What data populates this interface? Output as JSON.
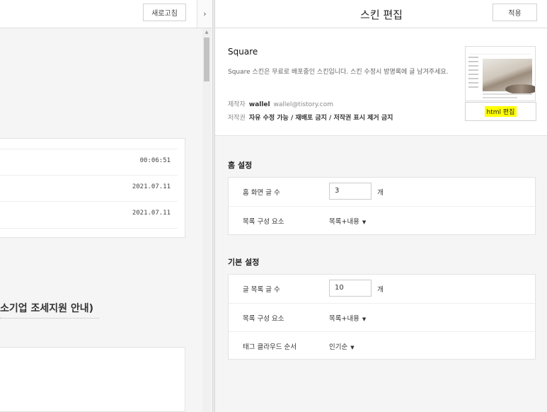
{
  "preview": {
    "refresh_label": "새로고침",
    "collapse_icon": "›",
    "scroll_up_icon": "▲",
    "recent_dates": [
      "00:06:51",
      "2021.07.11",
      "2021.07.11"
    ],
    "section_title": "소기업 조세지원 안내)"
  },
  "editor": {
    "title": "스킨 편집",
    "apply_label": "적용",
    "skin": {
      "name": "Square",
      "description": "Square 스킨은 무료로 배포중인 스킨입니다. 스킨 수정시 방명록에 글 남겨주세요.",
      "author_label": "제작자",
      "author_name": "wallel",
      "author_email": "wallel@tistory.com",
      "license_label": "저작권",
      "license_text": "자유 수정 가능 / 재배포 금지 / 저작권 표시 제거 금지",
      "html_edit_label": "html 편집",
      "highlight_color": "#ffff00"
    },
    "home_settings": {
      "title": "홈 설정",
      "post_count_label": "홈 화면 글 수",
      "post_count_value": "3",
      "post_count_unit": "개",
      "list_component_label": "목록 구성 요소",
      "list_component_value": "목록+내용"
    },
    "basic_settings": {
      "title": "기본 설정",
      "list_count_label": "글 목록 글 수",
      "list_count_value": "10",
      "list_count_unit": "개",
      "list_component_label": "목록 구성 요소",
      "list_component_value": "목록+내용",
      "tag_cloud_label": "태그 클라우드 순서",
      "tag_cloud_value": "인기순"
    },
    "caret_icon": "▼"
  }
}
